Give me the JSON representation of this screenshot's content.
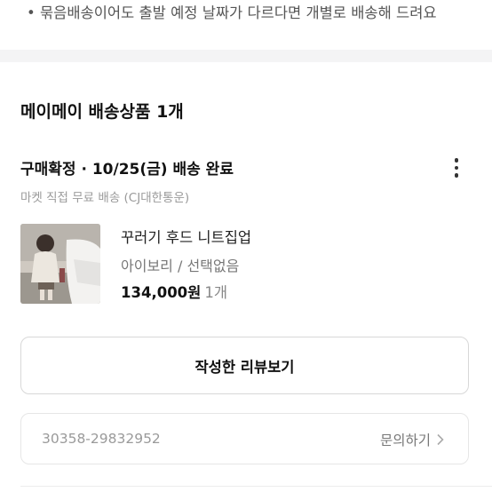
{
  "top_note": {
    "text": "• 묶음배송이어도 출발 예정 날짜가 다르다면 개별로 배송해 드려요"
  },
  "section": {
    "title": "메이메이 배송상품 1개"
  },
  "order": {
    "status": "구매확정 · 10/25(금) 배송 완료",
    "shipping_info": "마켓 직접 무료 배송 (CJ대한통운)",
    "product": {
      "name": "꾸러기 후드 니트집업",
      "option": "아이보리 / 선택없음",
      "price": "134,000원",
      "quantity": "1개"
    },
    "review_button": "작성한 리뷰보기",
    "order_number": "30358-29832952",
    "inquiry_label": "문의하기",
    "more_icon": "more-vertical-icon"
  },
  "colors": {
    "text_primary": "#111111",
    "text_secondary": "#9a9a9a",
    "divider": "#f4f4f5",
    "border": "#d8d8d8"
  }
}
